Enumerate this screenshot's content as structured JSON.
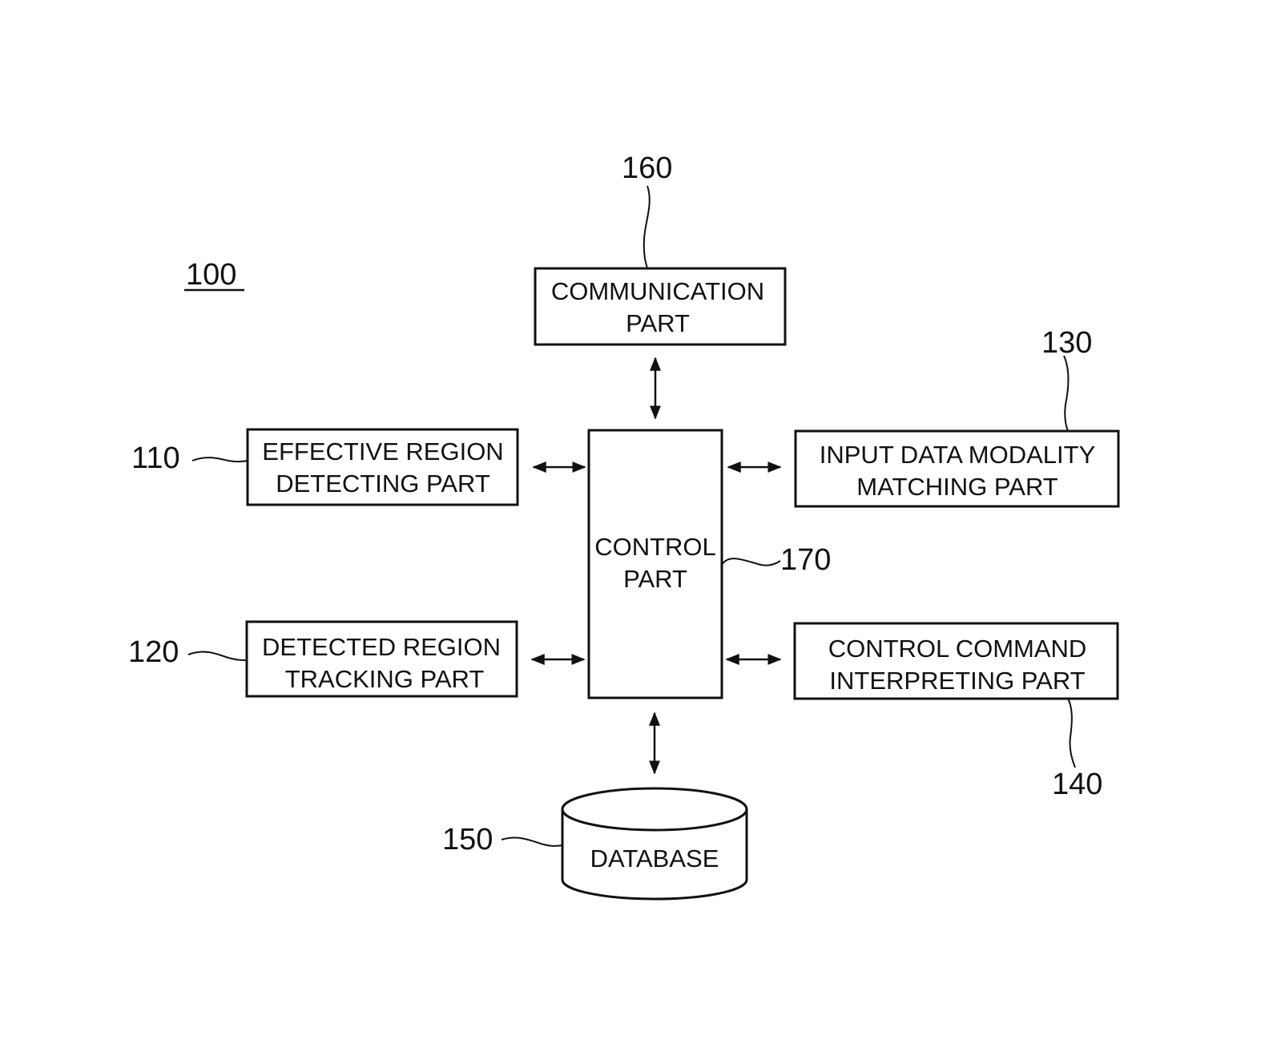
{
  "figure": {
    "system_ref": "100",
    "blocks": {
      "communication": {
        "ref": "160",
        "lines": [
          "COMMUNICATION",
          "PART"
        ]
      },
      "effective_region": {
        "ref": "110",
        "lines": [
          "EFFECTIVE REGION",
          "DETECTING PART"
        ]
      },
      "detected_region": {
        "ref": "120",
        "lines": [
          "DETECTED REGION",
          "TRACKING PART"
        ]
      },
      "input_modality": {
        "ref": "130",
        "lines": [
          "INPUT DATA MODALITY",
          "MATCHING PART"
        ]
      },
      "control_command": {
        "ref": "140",
        "lines": [
          "CONTROL COMMAND",
          "INTERPRETING PART"
        ]
      },
      "control": {
        "ref": "170",
        "lines": [
          "CONTROL",
          "PART"
        ]
      },
      "database": {
        "ref": "150",
        "lines": [
          "DATABASE"
        ]
      }
    },
    "connections": [
      {
        "from": "communication",
        "to": "control",
        "type": "bidirectional"
      },
      {
        "from": "effective_region",
        "to": "control",
        "type": "bidirectional"
      },
      {
        "from": "detected_region",
        "to": "control",
        "type": "bidirectional"
      },
      {
        "from": "input_modality",
        "to": "control",
        "type": "bidirectional"
      },
      {
        "from": "control_command",
        "to": "control",
        "type": "bidirectional"
      },
      {
        "from": "database",
        "to": "control",
        "type": "bidirectional"
      }
    ]
  }
}
